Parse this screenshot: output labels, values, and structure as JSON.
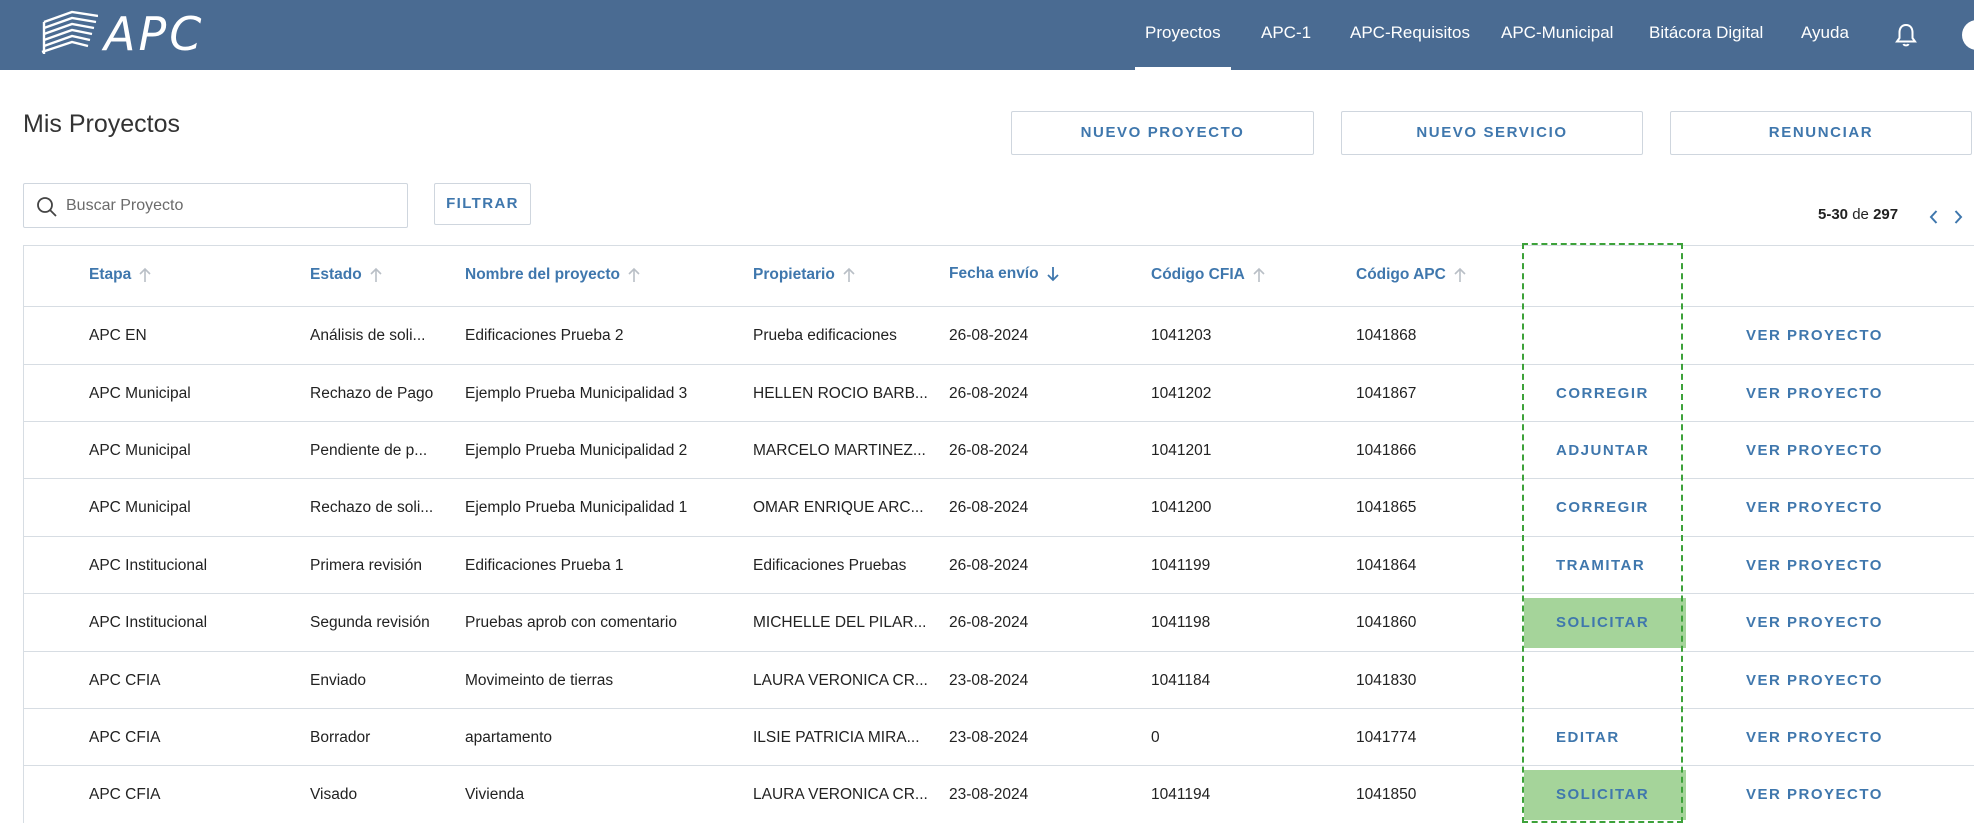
{
  "header": {
    "logo_text": "APC",
    "nav": [
      {
        "label": "Proyectos",
        "active": true
      },
      {
        "label": "APC-1",
        "active": false
      },
      {
        "label": "APC-Requisitos",
        "active": false
      },
      {
        "label": "APC-Municipal",
        "active": false
      },
      {
        "label": "Bitácora Digital",
        "active": false
      },
      {
        "label": "Ayuda",
        "active": false
      }
    ],
    "icons": [
      "bell-icon",
      "user-avatar"
    ]
  },
  "page": {
    "title": "Mis Proyectos",
    "actions": {
      "new_project": "NUEVO PROYECTO",
      "new_service": "NUEVO SERVICIO",
      "resign": "RENUNCIAR"
    },
    "search": {
      "placeholder": "Buscar Proyecto",
      "value": ""
    },
    "filter_label": "FILTRAR",
    "pagination": {
      "range": "5-30",
      "of_label": "de",
      "total": "297"
    }
  },
  "table": {
    "columns": [
      {
        "label": "Etapa",
        "sort": "asc"
      },
      {
        "label": "Estado",
        "sort": "asc"
      },
      {
        "label": "Nombre del proyecto",
        "sort": "asc"
      },
      {
        "label": "Propietario",
        "sort": "asc"
      },
      {
        "label": "Fecha envío",
        "sort": "desc"
      },
      {
        "label": "Código CFIA",
        "sort": "asc"
      },
      {
        "label": "Código APC",
        "sort": "asc"
      }
    ],
    "rows": [
      {
        "etapa": "APC EN",
        "estado": "Análisis de soli...",
        "nombre": "Edificaciones Prueba 2",
        "propietario": "Prueba edificaciones",
        "fecha": "26-08-2024",
        "cfia": "1041203",
        "apc": "1041868",
        "action": "",
        "highlight": false,
        "view": "VER PROYECTO"
      },
      {
        "etapa": "APC Municipal",
        "estado": "Rechazo de Pago",
        "nombre": "Ejemplo Prueba Municipalidad 3",
        "propietario": "HELLEN ROCIO BARB...",
        "fecha": "26-08-2024",
        "cfia": "1041202",
        "apc": "1041867",
        "action": "CORREGIR",
        "highlight": false,
        "view": "VER PROYECTO"
      },
      {
        "etapa": "APC Municipal",
        "estado": "Pendiente de p...",
        "nombre": "Ejemplo Prueba Municipalidad 2",
        "propietario": "MARCELO MARTINEZ...",
        "fecha": "26-08-2024",
        "cfia": "1041201",
        "apc": "1041866",
        "action": "ADJUNTAR",
        "highlight": false,
        "view": "VER PROYECTO"
      },
      {
        "etapa": "APC Municipal",
        "estado": "Rechazo de soli...",
        "nombre": "Ejemplo Prueba Municipalidad 1",
        "propietario": "OMAR ENRIQUE ARC...",
        "fecha": "26-08-2024",
        "cfia": "1041200",
        "apc": "1041865",
        "action": "CORREGIR",
        "highlight": false,
        "view": "VER PROYECTO"
      },
      {
        "etapa": "APC Institucional",
        "estado": "Primera revisión",
        "nombre": "Edificaciones Prueba 1",
        "propietario": "Edificaciones Pruebas",
        "fecha": "26-08-2024",
        "cfia": "1041199",
        "apc": "1041864",
        "action": "TRAMITAR",
        "highlight": false,
        "view": "VER PROYECTO"
      },
      {
        "etapa": "APC Institucional",
        "estado": "Segunda revisión",
        "nombre": "Pruebas aprob con comentario",
        "propietario": "MICHELLE DEL PILAR...",
        "fecha": "26-08-2024",
        "cfia": "1041198",
        "apc": "1041860",
        "action": "SOLICITAR",
        "highlight": true,
        "view": "VER PROYECTO"
      },
      {
        "etapa": "APC CFIA",
        "estado": "Enviado",
        "nombre": "Movimeinto de tierras",
        "propietario": "LAURA VERONICA CR...",
        "fecha": "23-08-2024",
        "cfia": "1041184",
        "apc": "1041830",
        "action": "",
        "highlight": false,
        "view": "VER PROYECTO"
      },
      {
        "etapa": "APC CFIA",
        "estado": "Borrador",
        "nombre": "apartamento",
        "propietario": "ILSIE PATRICIA MIRA...",
        "fecha": "23-08-2024",
        "cfia": "0",
        "apc": "1041774",
        "action": "EDITAR",
        "highlight": false,
        "view": "VER PROYECTO"
      },
      {
        "etapa": "APC CFIA",
        "estado": "Visado",
        "nombre": "Vivienda",
        "propietario": "LAURA VERONICA CR...",
        "fecha": "23-08-2024",
        "cfia": "1041194",
        "apc": "1041850",
        "action": "SOLICITAR",
        "highlight": true,
        "view": "VER PROYECTO"
      }
    ]
  },
  "colors": {
    "header_bg": "#4a6b92",
    "link": "#3f77ad",
    "highlight": "#a5d49a",
    "dashed_outline": "#3da23a"
  }
}
